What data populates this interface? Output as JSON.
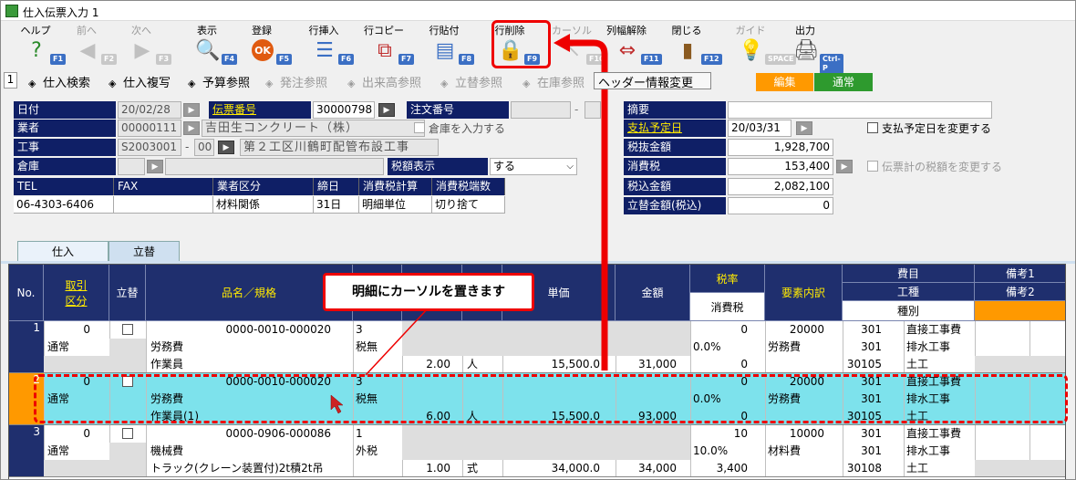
{
  "window": {
    "title": "仕入伝票入力 1"
  },
  "toolbar": [
    {
      "label": "ヘルプ",
      "fkey": "F1",
      "icon": "help-icon",
      "enabled": true
    },
    {
      "label": "前へ",
      "fkey": "F2",
      "icon": "arrow-left-icon",
      "enabled": false
    },
    {
      "label": "次へ",
      "fkey": "F3",
      "icon": "arrow-right-icon",
      "enabled": false
    },
    {
      "label": "表示",
      "fkey": "F4",
      "icon": "magnifier-icon",
      "enabled": true
    },
    {
      "label": "登録",
      "fkey": "F5",
      "icon": "ok-icon",
      "enabled": true
    },
    {
      "label": "行挿入",
      "fkey": "F6",
      "icon": "row-insert-icon",
      "enabled": true
    },
    {
      "label": "行コピー",
      "fkey": "F7",
      "icon": "row-copy-icon",
      "enabled": true
    },
    {
      "label": "行貼付",
      "fkey": "F8",
      "icon": "row-paste-icon",
      "enabled": true
    },
    {
      "label": "行削除",
      "fkey": "F9",
      "icon": "row-delete-icon",
      "enabled": true
    },
    {
      "label": "カーソル",
      "fkey": "F10",
      "icon": "cursor-icon",
      "enabled": false
    },
    {
      "label": "列幅解除",
      "fkey": "F11",
      "icon": "column-width-icon",
      "enabled": true
    },
    {
      "label": "閉じる",
      "fkey": "F12",
      "icon": "door-icon",
      "enabled": true
    },
    {
      "label": "ガイド",
      "fkey": "SPACE",
      "icon": "lightbulb-icon",
      "enabled": false
    },
    {
      "label": "出力",
      "fkey": "Ctrl-P",
      "icon": "printer-icon",
      "enabled": true
    }
  ],
  "subbar": {
    "number": "1",
    "items": [
      {
        "label": "仕入検索",
        "enabled": true
      },
      {
        "label": "仕入複写",
        "enabled": true
      },
      {
        "label": "予算参照",
        "enabled": true
      },
      {
        "label": "発注参照",
        "enabled": false
      },
      {
        "label": "出来高参照",
        "enabled": false
      },
      {
        "label": "立替参照",
        "enabled": false
      },
      {
        "label": "在庫参照",
        "enabled": false
      },
      {
        "label": "ヘッダー情報変更",
        "enabled": true
      }
    ],
    "mode_edit": "編集",
    "mode_normal": "通常"
  },
  "header": {
    "date_label": "日付",
    "date_value": "20/02/28",
    "slip_label": "伝票番号",
    "slip_value": "30000798",
    "order_label": "注文番号",
    "order_sep": "-",
    "vendor_label": "業者",
    "vendor_code": "00000111",
    "vendor_name": "吉田生コンクリート（株）",
    "warehouse_input_label": "倉庫を入力する",
    "project_label": "工事",
    "project_code": "S2003001",
    "project_sep": "-",
    "project_sub": "00",
    "project_name": "第２工区川鶴町配管布設工事",
    "warehouse_label": "倉庫",
    "tax_display_label": "税額表示",
    "tax_display_value": "する"
  },
  "info_table": {
    "headers": [
      "TEL",
      "FAX",
      "業者区分",
      "締日",
      "消費税計算",
      "消費税端数"
    ],
    "values": [
      "06-4303-6406",
      "",
      "材料関係",
      "31日",
      "明細単位",
      "切り捨て"
    ]
  },
  "summary": {
    "memo_label": "摘要",
    "paydate_label": "支払予定日",
    "paydate_value": "20/03/31",
    "paydate_change_label": "支払予定日を変更する",
    "pretax_label": "税抜金額",
    "pretax_value": "1,928,700",
    "tax_label": "消費税",
    "tax_value": "153,400",
    "tax_change_label": "伝票計の税額を変更する",
    "total_label": "税込金額",
    "total_value": "2,082,100",
    "advance_label": "立替金額(税込)",
    "advance_value": "0"
  },
  "tabs": [
    "仕入",
    "立替"
  ],
  "grid": {
    "headers": {
      "no": "No.",
      "torihiki": "取引\n区分",
      "tatekae": "立替",
      "hinmei": "品名／規格",
      "tanka": "単価",
      "kingaku": "金額",
      "zeiritsu": "税率",
      "shohizei": "消費税",
      "yoso": "要素内訳",
      "himoku": "費目",
      "koshu": "工種",
      "shubetsu": "種別",
      "biko1": "備考1",
      "biko2": "備考2"
    },
    "rows": [
      {
        "no": "1",
        "qty_a": "0",
        "kubun": "通常",
        "code": "0000-0010-000020",
        "name": "労務費",
        "spec": "作業員",
        "tax_flag_no": "3",
        "tax_flag": "税無",
        "qty": "2.00",
        "unit": "人",
        "price": "15,500.0",
        "amount": "31,000",
        "rate_top": "0",
        "rate": "0.0%",
        "tax": "0",
        "elem_code": "20000",
        "elem_name": "労務費",
        "c1": "301",
        "c2": "301",
        "c3": "30105",
        "t1": "直接工事費",
        "t2": "排水工事",
        "t3": "土工"
      },
      {
        "no": "2",
        "qty_a": "0",
        "kubun": "通常",
        "code": "0000-0010-000020",
        "name": "労務費",
        "spec": "作業員(1)",
        "tax_flag_no": "3",
        "tax_flag": "税無",
        "qty": "6.00",
        "unit": "人",
        "price": "15,500.0",
        "amount": "93,000",
        "rate_top": "0",
        "rate": "0.0%",
        "tax": "0",
        "elem_code": "20000",
        "elem_name": "労務費",
        "c1": "301",
        "c2": "301",
        "c3": "30105",
        "t1": "直接工事費",
        "t2": "排水工事",
        "t3": "土工"
      },
      {
        "no": "3",
        "qty_a": "0",
        "kubun": "通常",
        "code": "0000-0906-000086",
        "name": "機械費",
        "spec": "トラック(クレーン装置付)2t積2t吊",
        "tax_flag_no": "1",
        "tax_flag": "外税",
        "qty": "1.00",
        "unit": "式",
        "price": "34,000.0",
        "amount": "34,000",
        "rate_top": "10",
        "rate": "10.0%",
        "tax": "3,400",
        "elem_code": "10000",
        "elem_name": "材料費",
        "c1": "301",
        "c2": "301",
        "c3": "30108",
        "t1": "直接工事費",
        "t2": "排水工事",
        "t3": "土工"
      }
    ]
  },
  "callout": "明細にカーソルを置きます",
  "colors": {
    "navy": "#0f1f66",
    "grid_header": "#1f2f6e",
    "selected_row": "#7de2ec",
    "highlight": "#ee0000",
    "orange": "#ff9900",
    "green": "#2e9a2e"
  }
}
